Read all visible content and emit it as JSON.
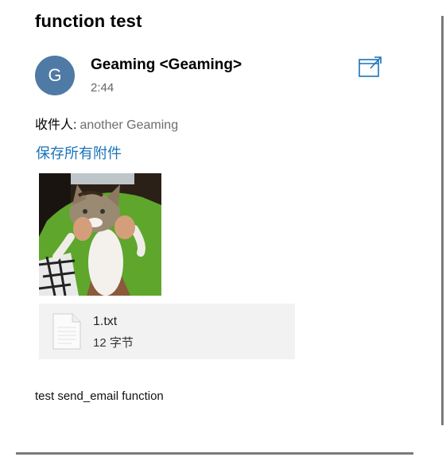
{
  "email": {
    "subject": "function test",
    "sender": {
      "initial": "G",
      "display": "Geaming <Geaming>",
      "avatar_color": "#4f7aa6"
    },
    "time": "2:44",
    "recipient_label": "收件人:",
    "recipient_value": "another Geaming",
    "save_all_label": "保存所有附件",
    "attachments": [
      {
        "kind": "image",
        "description_icon": "cat-photo"
      },
      {
        "kind": "file",
        "name": "1.txt",
        "size": "12 字节",
        "icon": "text-file-icon"
      }
    ],
    "body": "test send_email function"
  },
  "colors": {
    "link": "#1a73b8",
    "attachment_bg": "#f2f2f2",
    "scrollbar": "#7a7a7a"
  }
}
